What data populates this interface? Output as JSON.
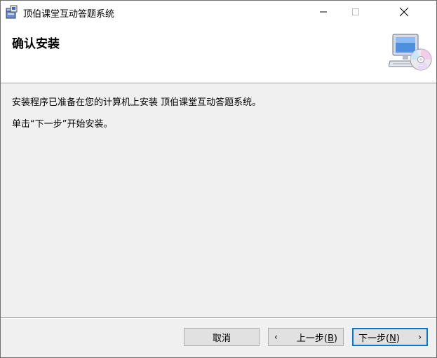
{
  "window": {
    "title": "顶伯课堂互动答题系统"
  },
  "banner": {
    "title": "确认安装"
  },
  "body": {
    "line1": "安装程序已准备在您的计算机上安装 顶伯课堂互动答题系统。",
    "line2": "单击“下一步”开始安装。"
  },
  "buttons": {
    "cancel": "取消",
    "back_prefix": "上一步(",
    "back_key": "B",
    "back_suffix": ")",
    "next_prefix": "下一步(",
    "next_key": "N",
    "next_suffix": ")"
  },
  "icons": {
    "app": "installer-package-icon",
    "banner": "computer-cd-icon",
    "minimize": "minimize-icon",
    "maximize": "maximize-icon",
    "close": "close-icon"
  },
  "colors": {
    "dialog_bg": "#f0f0f0",
    "button_bg": "#e1e1e1",
    "default_button_border": "#0078d7"
  }
}
